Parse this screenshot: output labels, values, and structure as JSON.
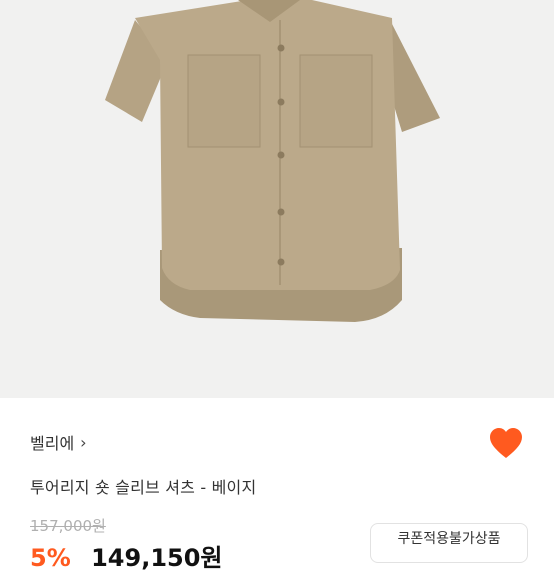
{
  "product": {
    "brand": "벨리에",
    "brand_chevron": "›",
    "name": "투어리지 숏 슬리브 셔츠 - 베이지",
    "original_price": "157,000원",
    "discount": "5%",
    "sale_price": "149,150원",
    "coupon_label": "쿠폰적용불가상품",
    "image_icon": "beige-shirt-photo",
    "wishlist_icon": "heart-icon"
  },
  "colors": {
    "accent": "#ff5a1f",
    "shirt": "#b9a788",
    "background": "#f1f1f0"
  }
}
